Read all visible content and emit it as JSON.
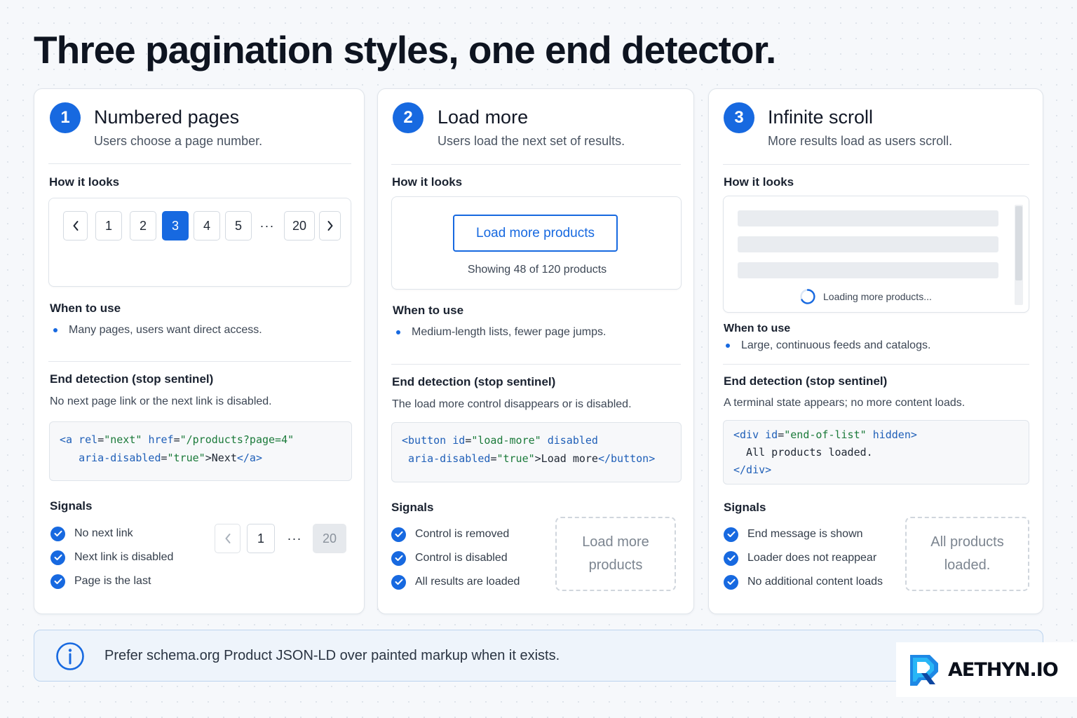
{
  "page": {
    "title": "Three pagination styles, one end detector."
  },
  "labels": {
    "how_it_looks": "How it looks",
    "when_to_use": "When to use",
    "end_detection": "End detection (stop sentinel)",
    "signals": "Signals"
  },
  "cards": [
    {
      "number": "1",
      "title": "Numbered pages",
      "subtitle": "Users choose a page number.",
      "demo": {
        "prev_icon": "chevron-left-icon",
        "next_icon": "chevron-right-icon",
        "pages": [
          "1",
          "2",
          "3",
          "4",
          "5"
        ],
        "active_page": "3",
        "ellipsis": "···",
        "last_page": "20"
      },
      "when_to_use": "Many pages, users want direct access.",
      "end_detection": "No next page link or the next link is disabled.",
      "code": [
        [
          {
            "t": "tag",
            "v": "<a "
          },
          {
            "t": "attr",
            "v": "rel"
          },
          {
            "t": "txt",
            "v": "="
          },
          {
            "t": "str",
            "v": "\"next\""
          },
          {
            "t": "txt",
            "v": " "
          },
          {
            "t": "attr",
            "v": "href"
          },
          {
            "t": "txt",
            "v": "="
          },
          {
            "t": "str",
            "v": "\"/products?page=4\""
          }
        ],
        [
          {
            "t": "txt",
            "v": "   "
          },
          {
            "t": "attr",
            "v": "aria-disabled"
          },
          {
            "t": "txt",
            "v": "="
          },
          {
            "t": "str",
            "v": "\"true\""
          },
          {
            "t": "txt",
            "v": ">Next"
          },
          {
            "t": "tag",
            "v": "</a>"
          }
        ]
      ],
      "signals": [
        "No next link",
        "Next link is disabled",
        "Page is the last"
      ],
      "signal_visual": {
        "prev_icon": "chevron-left-icon",
        "first": "1",
        "ellipsis": "···",
        "last": "20"
      }
    },
    {
      "number": "2",
      "title": "Load more",
      "subtitle": "Users load the next set of results.",
      "demo": {
        "button_label": "Load more products",
        "status": "Showing 48 of 120 products"
      },
      "when_to_use": "Medium-length lists, fewer page jumps.",
      "end_detection": "The load more control disappears or is disabled.",
      "code": [
        [
          {
            "t": "tag",
            "v": "<button "
          },
          {
            "t": "attr",
            "v": "id"
          },
          {
            "t": "txt",
            "v": "="
          },
          {
            "t": "str",
            "v": "\"load-more\""
          },
          {
            "t": "txt",
            "v": " "
          },
          {
            "t": "attr",
            "v": "disabled"
          }
        ],
        [
          {
            "t": "txt",
            "v": " "
          },
          {
            "t": "attr",
            "v": "aria-disabled"
          },
          {
            "t": "txt",
            "v": "="
          },
          {
            "t": "str",
            "v": "\"true\""
          },
          {
            "t": "txt",
            "v": ">Load more"
          },
          {
            "t": "tag",
            "v": "</button>"
          }
        ]
      ],
      "signals": [
        "Control is removed",
        "Control is disabled",
        "All results are loaded"
      ],
      "signal_visual": {
        "text": "Load more products"
      }
    },
    {
      "number": "3",
      "title": "Infinite scroll",
      "subtitle": "More results load as users scroll.",
      "demo": {
        "loading_text": "Loading more products..."
      },
      "when_to_use": "Large, continuous feeds and catalogs.",
      "end_detection": "A terminal state appears; no more content loads.",
      "code": [
        [
          {
            "t": "tag",
            "v": "<div "
          },
          {
            "t": "attr",
            "v": "id"
          },
          {
            "t": "txt",
            "v": "="
          },
          {
            "t": "str",
            "v": "\"end-of-list\""
          },
          {
            "t": "txt",
            "v": " "
          },
          {
            "t": "attr",
            "v": "hidden"
          },
          {
            "t": "tag",
            "v": ">"
          }
        ],
        [
          {
            "t": "txt",
            "v": "  All products loaded."
          }
        ],
        [
          {
            "t": "tag",
            "v": "</div>"
          }
        ]
      ],
      "signals": [
        "End message is shown",
        "Loader does not reappear",
        "No additional content loads"
      ],
      "signal_visual": {
        "text": "All products loaded."
      }
    }
  ],
  "info": {
    "icon": "info-icon",
    "text": "Prefer schema.org Product JSON-LD over painted markup when it exists."
  },
  "logo": {
    "text": "AETHYN.IO"
  },
  "colors": {
    "accent": "#1769e0",
    "title": "#0e1420",
    "info_bg": "#eef4fb"
  }
}
